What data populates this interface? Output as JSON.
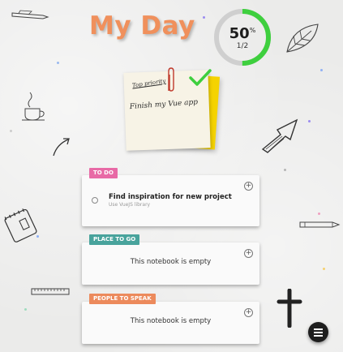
{
  "title": "My Day",
  "progress": {
    "percent": "50",
    "percent_unit": "%",
    "fraction": "1/2",
    "value": 0.5,
    "color": "#3ecf3e"
  },
  "sticky_note": {
    "label": "Top priority",
    "text": "Finish my Vue app"
  },
  "lists": [
    {
      "tag": "TO DO",
      "tag_color": "#e86aa6",
      "add_icon": "+",
      "tasks": [
        {
          "title": "Find inspiration for new project",
          "subtitle": "Use VueJS library"
        }
      ]
    },
    {
      "tag": "PLACE TO GO",
      "tag_color": "#48a39c",
      "add_icon": "+",
      "empty_text": "This notebook is empty"
    },
    {
      "tag": "PEOPLE TO SPEAK",
      "tag_color": "#ec8a5c",
      "add_icon": "+",
      "empty_text": "This notebook is empty"
    }
  ],
  "menu": {
    "icon": "hamburger-menu-icon"
  },
  "icons": [
    "pen-icon",
    "coffee-cup-icon",
    "arrow-curve-icon",
    "notebook-icon",
    "ruler-icon",
    "leaf-icon",
    "cursor-arrow-icon",
    "pencil-icon",
    "cross-icon",
    "checkmark-icon",
    "paperclip-icon"
  ]
}
